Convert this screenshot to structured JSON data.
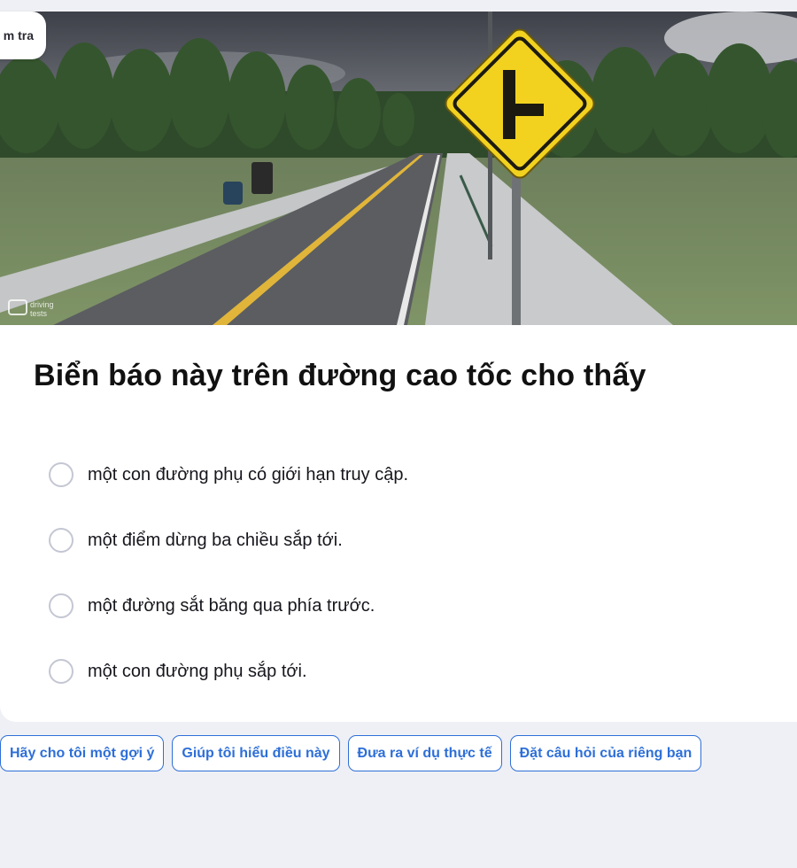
{
  "badge": {
    "label": "m tra"
  },
  "illustration": {
    "sign_icon": "side-road-right-warning-sign",
    "watermark": "drivingtests"
  },
  "question": {
    "text": "Biển báo này trên đường cao tốc cho thấy"
  },
  "options": [
    {
      "label": "một con đường phụ có giới hạn truy cập."
    },
    {
      "label": "một điểm dừng ba chiều sắp tới."
    },
    {
      "label": "một đường sắt băng qua phía trước."
    },
    {
      "label": "một con đường phụ sắp tới."
    }
  ],
  "suggestions": [
    {
      "label": "Hãy cho tôi một gợi ý"
    },
    {
      "label": "Giúp tôi hiểu điều này"
    },
    {
      "label": "Đưa ra ví dụ thực tế"
    },
    {
      "label": "Đặt câu hỏi của riêng bạn"
    }
  ],
  "colors": {
    "accent": "#2e6fd8",
    "page_background": "#eff0f5",
    "sign_yellow": "#f2d21f"
  }
}
